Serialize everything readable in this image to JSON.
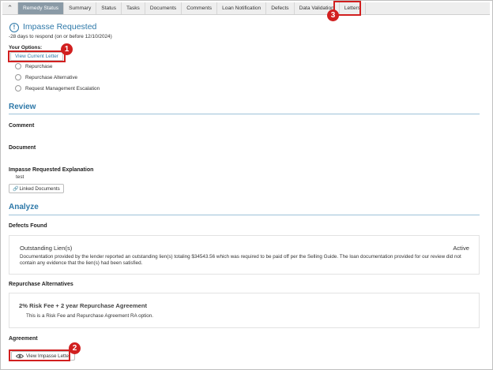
{
  "tabs": [
    {
      "label": "Remedy Status",
      "active": true
    },
    {
      "label": "Summary",
      "active": false
    },
    {
      "label": "Status",
      "active": false
    },
    {
      "label": "Tasks",
      "active": false
    },
    {
      "label": "Documents",
      "active": false
    },
    {
      "label": "Comments",
      "active": false
    },
    {
      "label": "Loan Notification",
      "active": false
    },
    {
      "label": "Defects",
      "active": false
    },
    {
      "label": "Data Validation",
      "active": false
    },
    {
      "label": "Letters",
      "active": false
    }
  ],
  "status": {
    "title": "Impasse Requested",
    "days_to_respond": "-28 days to respond (on or before 12/10/2024)"
  },
  "options": {
    "label": "Your Options:",
    "view_letter_label": "View Current Letter",
    "choices": [
      "Repurchase",
      "Repurchase Alternative",
      "Request Management Escalation"
    ]
  },
  "review": {
    "title": "Review",
    "comment_label": "Comment",
    "document_label": "Document",
    "explanation_label": "Impasse Requested Explanation",
    "explanation_value": "test",
    "linked_docs_label": "Linked Documents"
  },
  "analyze": {
    "title": "Analyze",
    "defects_label": "Defects Found",
    "defect": {
      "title": "Outstanding Lien(s)",
      "status": "Active",
      "description": "Documentation provided by the lender reported an outstanding lien(s) totaling $34543.56 which was required to be paid off per the Selling Guide. The loan documentation provided for our review did not contain any evidence that the lien(s) had been satisfied."
    },
    "alternatives_label": "Repurchase Alternatives",
    "alternative": {
      "title": "2% Risk Fee + 2 year Repurchase Agreement",
      "description": "This is a Risk Fee and Repurchase Agreement RA option."
    },
    "agreement_label": "Agreement",
    "view_impasse_label": "View Impasse Letter"
  },
  "callouts": [
    "1",
    "2",
    "3"
  ],
  "colors": {
    "accent": "#2d78a8",
    "callout": "#d11f1f",
    "active_tab": "#8a9aa6"
  }
}
